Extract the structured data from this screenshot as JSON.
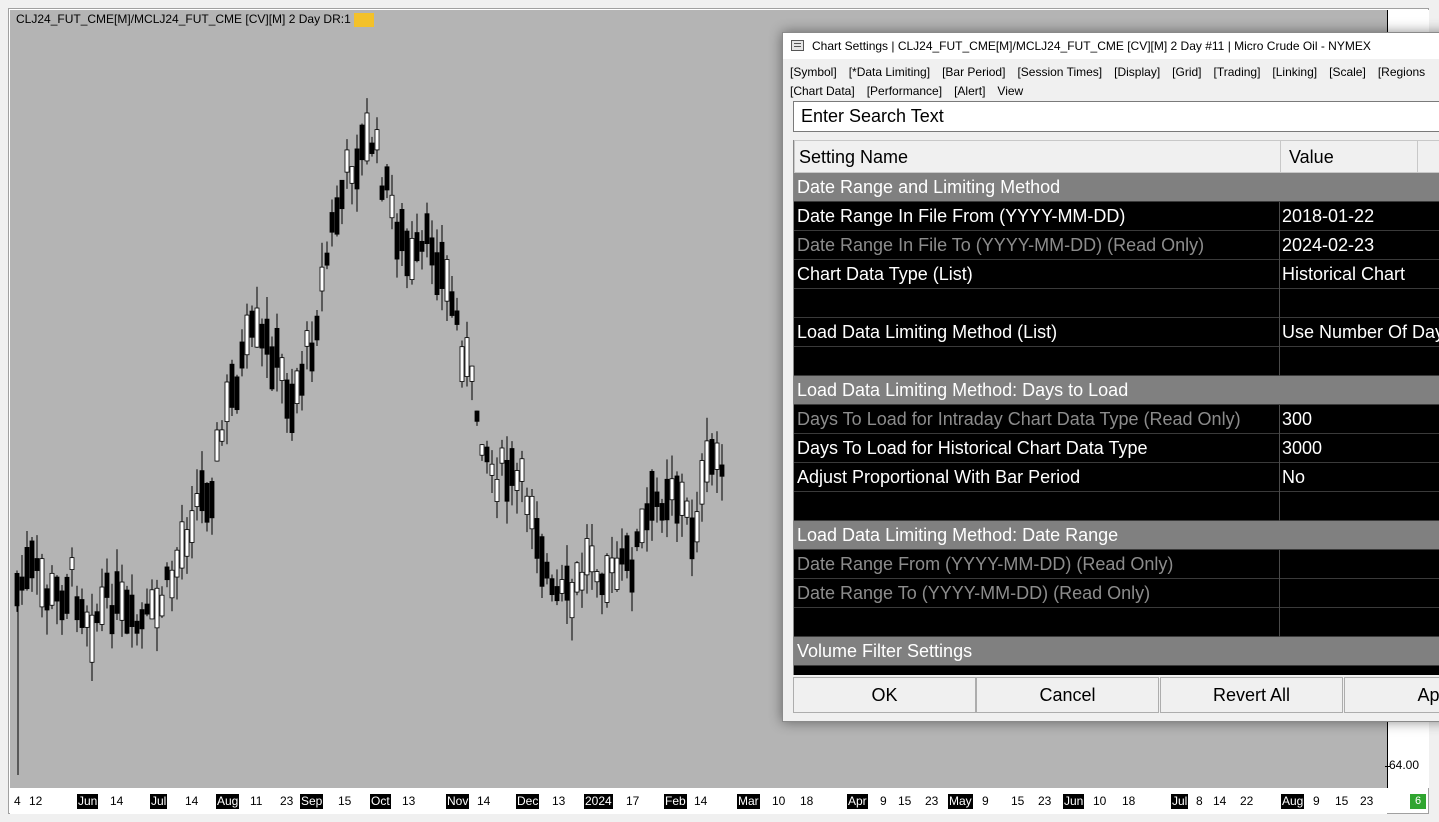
{
  "chart": {
    "title": "CLJ24_FUT_CME[M]/MCLJ24_FUT_CME [CV][M] 2 Day DR:1",
    "price_tick": "64.00",
    "corner_badge": "6",
    "bg_color": "#b4b4b4",
    "date_labels": [
      {
        "text": "4",
        "month": false
      },
      {
        "text": "12",
        "month": false
      },
      {
        "text": "Jun",
        "month": true
      },
      {
        "text": "14",
        "month": false
      },
      {
        "text": "Jul",
        "month": true
      },
      {
        "text": "14",
        "month": false
      },
      {
        "text": "Aug",
        "month": true
      },
      {
        "text": "11",
        "month": false
      },
      {
        "text": "23",
        "month": false
      },
      {
        "text": "Sep",
        "month": true
      },
      {
        "text": "15",
        "month": false
      },
      {
        "text": "Oct",
        "month": true
      },
      {
        "text": "13",
        "month": false
      },
      {
        "text": "Nov",
        "month": true
      },
      {
        "text": "14",
        "month": false
      },
      {
        "text": "Dec",
        "month": true
      },
      {
        "text": "13",
        "month": false
      },
      {
        "text": "2024",
        "month": true
      },
      {
        "text": "17",
        "month": false
      },
      {
        "text": "Feb",
        "month": true
      },
      {
        "text": "14",
        "month": false
      },
      {
        "text": "Mar",
        "month": true
      },
      {
        "text": "10",
        "month": false
      },
      {
        "text": "18",
        "month": false
      },
      {
        "text": "Apr",
        "month": true
      },
      {
        "text": "9",
        "month": false
      },
      {
        "text": "15",
        "month": false
      },
      {
        "text": "23",
        "month": false
      },
      {
        "text": "May",
        "month": true
      },
      {
        "text": "9",
        "month": false
      },
      {
        "text": "15",
        "month": false
      },
      {
        "text": "23",
        "month": false
      },
      {
        "text": "Jun",
        "month": true
      },
      {
        "text": "10",
        "month": false
      },
      {
        "text": "18",
        "month": false
      },
      {
        "text": "Jul",
        "month": true
      },
      {
        "text": "8",
        "month": false
      },
      {
        "text": "14",
        "month": false
      },
      {
        "text": "22",
        "month": false
      },
      {
        "text": "Aug",
        "month": true
      },
      {
        "text": "9",
        "month": false
      },
      {
        "text": "15",
        "month": false
      },
      {
        "text": "23",
        "month": false
      }
    ]
  },
  "dialog": {
    "title": "Chart Settings | CLJ24_FUT_CME[M]/MCLJ24_FUT_CME [CV][M]  2 Day #11 | Micro Crude Oil - NYMEX",
    "tabs_row1": [
      "[Symbol]",
      "[*Data Limiting]",
      "[Bar Period]",
      "[Session Times]",
      "[Display]",
      "[Grid]",
      "[Trading]",
      "[Linking]",
      "[Scale]",
      "[Regions"
    ],
    "tabs_row2": [
      "[Chart Data]",
      "[Performance]",
      "[Alert]",
      "View"
    ],
    "search_placeholder": "Enter Search Text",
    "header": {
      "name": "Setting Name",
      "value": "Value"
    },
    "rows": [
      {
        "type": "section",
        "name": "Date Range and Limiting Method",
        "value": ""
      },
      {
        "type": "setting",
        "name": "Date Range In File From (YYYY-MM-DD)",
        "value": "2018-01-22"
      },
      {
        "type": "readonly",
        "name": "Date Range In File To (YYYY-MM-DD) (Read Only)",
        "value": "2024-02-23"
      },
      {
        "type": "setting",
        "name": "Chart Data Type (List)",
        "value": "Historical Chart"
      },
      {
        "type": "blank",
        "name": "",
        "value": ""
      },
      {
        "type": "setting",
        "name": "Load Data Limiting Method (List)",
        "value": "Use Number Of Day"
      },
      {
        "type": "blank",
        "name": "",
        "value": ""
      },
      {
        "type": "section",
        "name": "Load Data Limiting Method: Days to Load",
        "value": ""
      },
      {
        "type": "readonly",
        "name": "Days To Load for Intraday Chart Data Type (Read Only)",
        "value": "300"
      },
      {
        "type": "setting",
        "name": "Days To Load for Historical Chart Data Type",
        "value": "3000"
      },
      {
        "type": "setting",
        "name": "Adjust Proportional With Bar Period",
        "value": "No"
      },
      {
        "type": "blank",
        "name": "",
        "value": ""
      },
      {
        "type": "section",
        "name": "Load Data Limiting Method: Date Range",
        "value": ""
      },
      {
        "type": "readonly",
        "name": "Date Range From (YYYY-MM-DD) (Read Only)",
        "value": ""
      },
      {
        "type": "readonly",
        "name": "Date Range To (YYYY-MM-DD) (Read Only)",
        "value": ""
      },
      {
        "type": "blank",
        "name": "",
        "value": ""
      },
      {
        "type": "section",
        "name": "Volume Filter Settings",
        "value": ""
      }
    ],
    "buttons": {
      "ok": "OK",
      "cancel": "Cancel",
      "revert": "Revert All",
      "apply": "Appl"
    }
  }
}
